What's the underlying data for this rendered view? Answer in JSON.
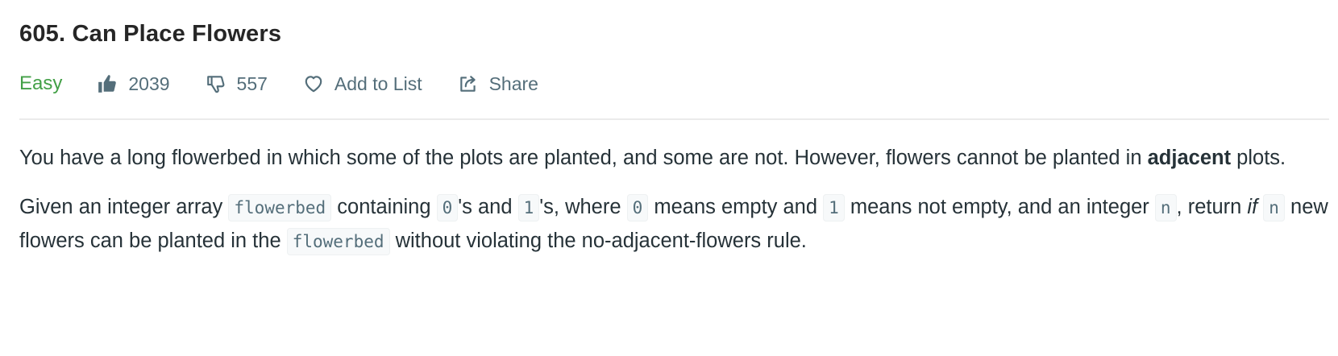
{
  "problem": {
    "title": "605. Can Place Flowers",
    "difficulty": "Easy",
    "difficulty_color": "#43a047",
    "likes": "2039",
    "dislikes": "557",
    "add_to_list_label": "Add to List",
    "share_label": "Share",
    "icons": {
      "like": "thumbs-up-icon",
      "dislike": "thumbs-down-icon",
      "add_to_list": "heart-icon",
      "share": "share-icon"
    }
  },
  "description": {
    "p1": {
      "t1": "You have a long flowerbed in which some of the plots are planted, and some are not. However, flowers cannot be planted in ",
      "bold": "adjacent",
      "t2": " plots."
    },
    "p2": {
      "t1": "Given an integer array ",
      "code1": "flowerbed",
      "t2": " containing ",
      "code2": "0",
      "t3": "'s and ",
      "code3": "1",
      "t4": "'s, where ",
      "code4": "0",
      "t5": " means empty and ",
      "code5": "1",
      "t6": " means not empty, and an integer ",
      "code6": "n",
      "t7": ", return ",
      "italic": "if",
      "t8": " ",
      "code7": "n",
      "t9": " new flowers can be planted in the ",
      "code8": "flowerbed",
      "t10": " without violating the no-adjacent-flowers rule."
    }
  }
}
